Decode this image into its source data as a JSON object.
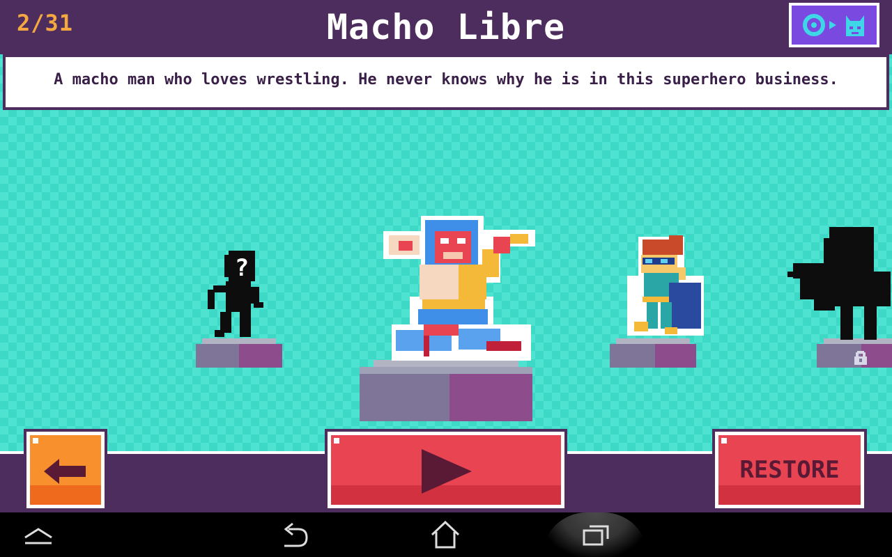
{
  "header": {
    "counter": "2/31",
    "title": "Macho Libre",
    "vr_button_icon": "vr-cardboard-cat-icon"
  },
  "description": "A macho man who loves wrestling. He never knows why he is in this superhero business.",
  "characters": [
    {
      "name": "mystery",
      "state": "unknown",
      "mark": "?"
    },
    {
      "name": "Macho Libre",
      "state": "selected"
    },
    {
      "name": "goggles-hero",
      "state": "unlocked"
    },
    {
      "name": "caped-hero",
      "state": "locked",
      "icon": "lock-icon"
    }
  ],
  "buttons": {
    "back_icon": "arrow-left-icon",
    "play_icon": "play-icon",
    "restore_label": "RESTORE"
  },
  "colors": {
    "header_bg": "#4d2d5d",
    "counter": "#f5a742",
    "stage_bg": "#3dd9c6",
    "play_button": "#e84452",
    "back_button": "#f7902d",
    "vr_button": "#7a4ae0"
  },
  "navbar": {
    "icons": [
      "collapse-icon",
      "back-nav-icon",
      "home-icon",
      "recent-apps-icon"
    ]
  }
}
